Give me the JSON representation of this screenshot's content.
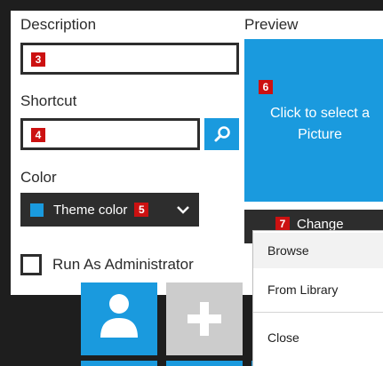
{
  "description": {
    "label": "Description",
    "badge": "3",
    "value": ""
  },
  "shortcut": {
    "label": "Shortcut",
    "badge": "4",
    "value": "",
    "search_icon": "search-icon"
  },
  "color": {
    "label": "Color",
    "selected": "Theme color",
    "badge": "5",
    "swatch": "#1a9ade",
    "chevron_icon": "chevron-down-icon"
  },
  "run_as_admin": {
    "label": "Run As Administrator",
    "checked": false
  },
  "preview": {
    "label": "Preview",
    "badge": "6",
    "text": "Click to select a Picture"
  },
  "change": {
    "label": "Change",
    "badge": "7"
  },
  "menu": {
    "items": [
      "Browse",
      "From Library",
      "Close"
    ]
  },
  "tiles": {
    "user_icon": "user-icon",
    "add_icon": "plus-icon"
  },
  "colors": {
    "accent": "#1a9ade",
    "dark": "#2d2d2d",
    "badge": "#cc1111"
  }
}
